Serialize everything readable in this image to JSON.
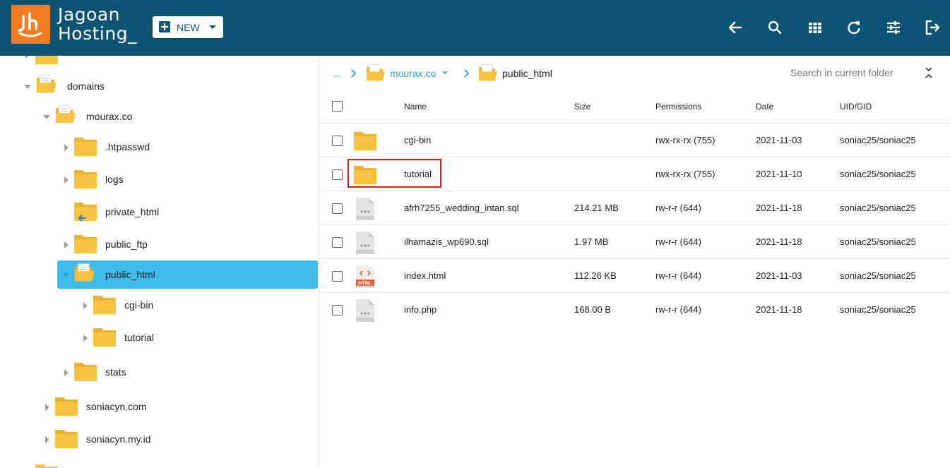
{
  "header": {
    "brand_line1": "Jagoan",
    "brand_line2": "Hosting_",
    "new_label": "NEW",
    "toolbar_icons": [
      "back-arrow-icon",
      "search-icon",
      "grid-view-icon",
      "refresh-icon",
      "settings-sliders-icon",
      "logout-icon"
    ]
  },
  "colors": {
    "topbar": "#0d5474",
    "accent": "#3ebdeb",
    "logo": "#f57c1f",
    "folder": "#f6c342",
    "highlight": "#e41b1b"
  },
  "tree": {
    "items": [
      {
        "label": "domains"
      },
      {
        "label": "mourax.co"
      },
      {
        "label": ".htpasswd"
      },
      {
        "label": "logs"
      },
      {
        "label": "private_html"
      },
      {
        "label": "public_ftp"
      },
      {
        "label": "public_html"
      },
      {
        "label": "cgi-bin"
      },
      {
        "label": "tutorial"
      },
      {
        "label": "stats"
      },
      {
        "label": "soniacyn.com"
      },
      {
        "label": "soniacyn.my.id"
      }
    ]
  },
  "breadcrumb": {
    "ellipsis": "...",
    "items": [
      {
        "label": "mourax.co"
      },
      {
        "label": "public_html"
      }
    ],
    "search_placeholder": "Search in current folder"
  },
  "table": {
    "columns": [
      "Name",
      "Size",
      "Permissions",
      "Date",
      "UID/GID"
    ],
    "rows": [
      {
        "name": "cgi-bin",
        "size": "",
        "perm": "rwx-rx-rx (755)",
        "date": "2021-11-03",
        "uid": "soniac25/soniac25",
        "type": "folder"
      },
      {
        "name": "tutorial",
        "size": "",
        "perm": "rwx-rx-rx (755)",
        "date": "2021-11-10",
        "uid": "soniac25/soniac25",
        "type": "folder"
      },
      {
        "name": "afrh7255_wedding_intan.sql",
        "size": "214.21 MB",
        "perm": "rw-r-r (644)",
        "date": "2021-11-18",
        "uid": "soniac25/soniac25",
        "type": "file"
      },
      {
        "name": "ilhamazis_wp690.sql",
        "size": "1.97 MB",
        "perm": "rw-r-r (644)",
        "date": "2021-11-18",
        "uid": "soniac25/soniac25",
        "type": "file"
      },
      {
        "name": "index.html",
        "size": "112.26 KB",
        "perm": "rw-r-r (644)",
        "date": "2021-11-03",
        "uid": "soniac25/soniac25",
        "type": "html"
      },
      {
        "name": "info.php",
        "size": "168.00 B",
        "perm": "rw-r-r (644)",
        "date": "2021-11-18",
        "uid": "soniac25/soniac25",
        "type": "file"
      }
    ],
    "html_badge": "HTML"
  }
}
